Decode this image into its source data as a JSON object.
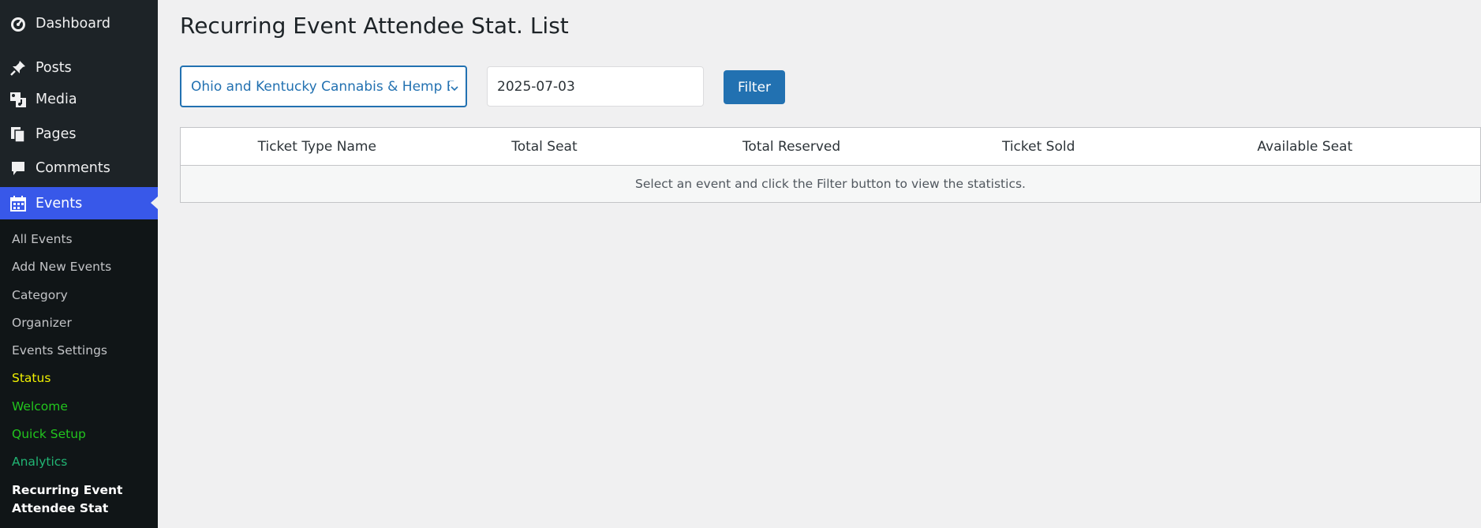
{
  "sidebar": {
    "top_items": [
      {
        "label": "Dashboard",
        "icon": "dashboard-icon"
      },
      {
        "label": "Posts",
        "icon": "pin-icon"
      },
      {
        "label": "Media",
        "icon": "media-icon"
      },
      {
        "label": "Pages",
        "icon": "pages-icon"
      },
      {
        "label": "Comments",
        "icon": "comment-icon"
      },
      {
        "label": "Events",
        "icon": "calendar-icon",
        "current": true
      }
    ],
    "submenu": [
      {
        "label": "All Events",
        "color": "#c3c4c7"
      },
      {
        "label": "Add New Events",
        "color": "#c3c4c7"
      },
      {
        "label": "Category",
        "color": "#c3c4c7"
      },
      {
        "label": "Organizer",
        "color": "#c3c4c7"
      },
      {
        "label": "Events Settings",
        "color": "#c3c4c7"
      },
      {
        "label": "Status",
        "color": "#f0f000"
      },
      {
        "label": "Welcome",
        "color": "#22c51e"
      },
      {
        "label": "Quick Setup",
        "color": "#22c51e"
      },
      {
        "label": "Analytics",
        "color": "#21b574"
      },
      {
        "label": "Recurring Event Attendee Stat",
        "color": "#ffffff"
      }
    ]
  },
  "page": {
    "title": "Recurring Event Attendee Stat. List"
  },
  "filters": {
    "event_selected": "Ohio and Kentucky Cannabis & Hemp Expo",
    "date_value": "2025-07-03",
    "filter_label": "Filter"
  },
  "table": {
    "columns": [
      "Ticket Type Name",
      "Total Seat",
      "Total Reserved",
      "Ticket Sold",
      "Available Seat"
    ],
    "empty_message": "Select an event and click the Filter button to view the statistics."
  },
  "colors": {
    "sidebar_bg": "#1d2327",
    "submenu_bg": "#101517",
    "active_menu": "#3858e9",
    "primary_button": "#2271b1"
  }
}
